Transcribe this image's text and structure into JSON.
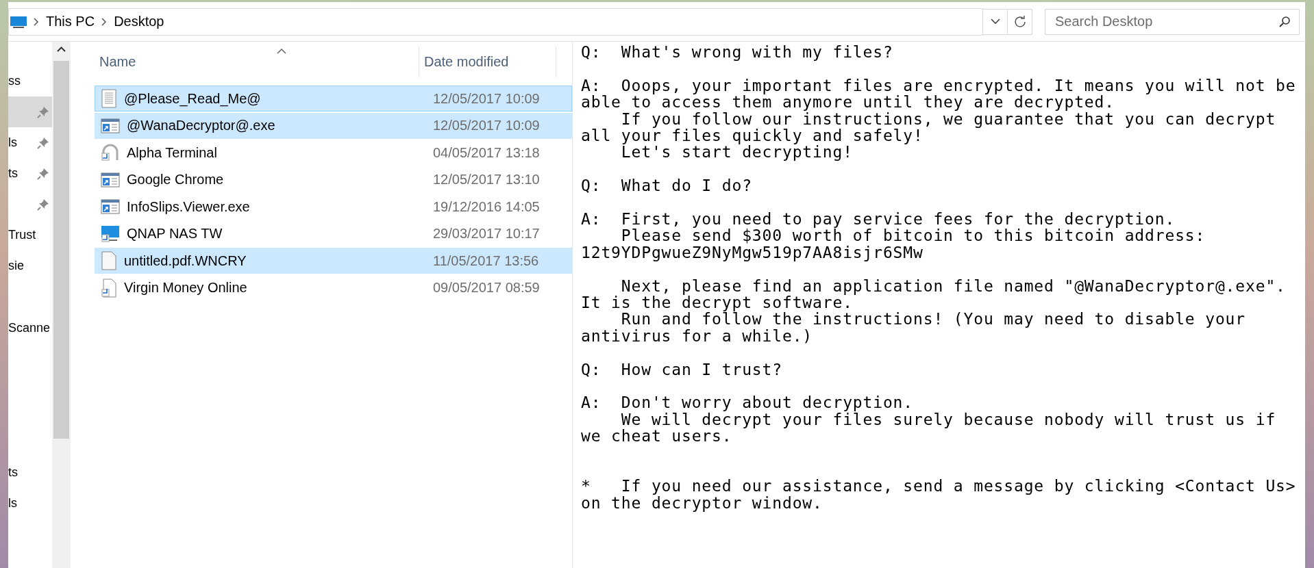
{
  "address_bar": {
    "path": [
      "This PC",
      "Desktop"
    ]
  },
  "search": {
    "placeholder": "Search Desktop"
  },
  "sidebar": {
    "groups": [
      {
        "items": [
          {
            "label": "ss",
            "pinned": false,
            "selected": false
          },
          {
            "pinned": true,
            "selected": true
          },
          {
            "label": "ls",
            "pinned": true,
            "selected": false
          },
          {
            "label": "ts",
            "pinned": true,
            "selected": false
          },
          {
            "pinned": true,
            "selected": false
          },
          {
            "label": "Trust",
            "pinned": false,
            "selected": false
          },
          {
            "label": "sie",
            "pinned": false,
            "selected": false
          }
        ]
      },
      {
        "items": [
          {
            "label": "Scanne",
            "pinned": false,
            "selected": false
          }
        ]
      },
      {
        "items": [
          {
            "label": "ts",
            "pinned": false,
            "selected": false
          },
          {
            "label": "ls",
            "pinned": false,
            "selected": false
          }
        ]
      }
    ]
  },
  "file_list": {
    "columns": [
      "Name",
      "Date modified"
    ],
    "rows": [
      {
        "name": "@Please_Read_Me@",
        "date": "12/05/2017 10:09",
        "kind": "text",
        "selected": true
      },
      {
        "name": "@WanaDecryptor@.exe",
        "date": "12/05/2017 10:09",
        "kind": "app",
        "selected": true
      },
      {
        "name": "Alpha Terminal",
        "date": "04/05/2017 13:18",
        "kind": "arc",
        "selected": false
      },
      {
        "name": "Google Chrome",
        "date": "12/05/2017 13:10",
        "kind": "app",
        "selected": false
      },
      {
        "name": "InfoSlips.Viewer.exe",
        "date": "19/12/2016 14:05",
        "kind": "app",
        "selected": false
      },
      {
        "name": "QNAP NAS TW",
        "date": "29/03/2017 10:17",
        "kind": "monitor",
        "selected": false
      },
      {
        "name": "untitled.pdf.WNCRY",
        "date": "11/05/2017 13:56",
        "kind": "blank",
        "selected": true
      },
      {
        "name": "Virgin Money Online",
        "date": "09/05/2017 08:59",
        "kind": "doc",
        "selected": false
      }
    ]
  },
  "preview": {
    "blocks": [
      {
        "kind": "text",
        "lines": [
          "Q:  What's wrong with my files?"
        ]
      },
      {
        "kind": "text",
        "lines": [
          "A:  Ooops, your important files are encrypted. It means you will not be",
          "able to access them anymore until they are decrypted.",
          "    If you follow our instructions, we guarantee that you can decrypt",
          "all your files quickly and safely!",
          "    Let's start decrypting!"
        ]
      },
      {
        "kind": "text",
        "lines": [
          "Q:  What do I do?"
        ]
      },
      {
        "kind": "text",
        "lines": [
          "A:  First, you need to pay service fees for the decryption.",
          "    Please send $300 worth of bitcoin to this bitcoin address:",
          "12t9YDPgwueZ9NyMgw519p7AA8isjr6SMw"
        ]
      },
      {
        "kind": "text",
        "lines": [
          "    Next, please find an application file named \"@WanaDecryptor@.exe\".",
          "It is the decrypt software.",
          "    Run and follow the instructions! (You may need to disable your",
          "antivirus for a while.)"
        ]
      },
      {
        "kind": "text",
        "lines": [
          "Q:  How can I trust?"
        ]
      },
      {
        "kind": "text",
        "lines": [
          "A:  Don't worry about decryption.",
          "    We will decrypt your files surely because nobody will trust us if",
          "we cheat users."
        ]
      },
      {
        "kind": "footnote",
        "lines": [
          "*   If you need our assistance, send a message by clicking <Contact Us>",
          "on the decryptor window."
        ]
      }
    ]
  }
}
